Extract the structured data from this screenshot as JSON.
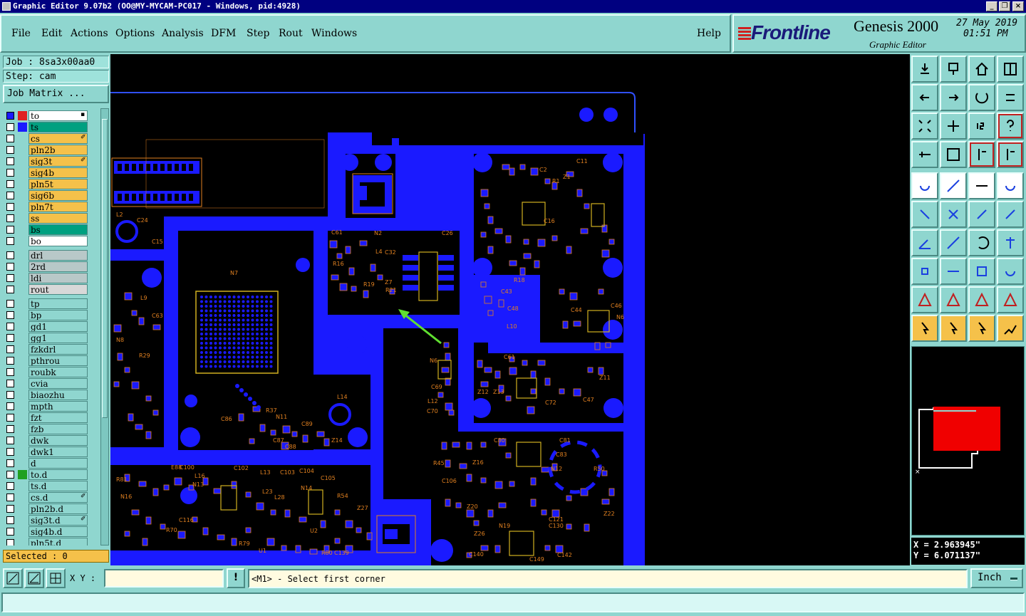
{
  "window": {
    "title": "Graphic Editor 9.07b2  (OO@MY-MYCAM-PC017 - Windows, pid:4928)",
    "minimize_glyph": "_",
    "restore_glyph": "❐",
    "close_glyph": "×"
  },
  "menu": {
    "items": [
      "File",
      "Edit",
      "Actions",
      "Options",
      "Analysis",
      "DFM",
      "Step",
      "Rout",
      "Windows"
    ],
    "help": "Help"
  },
  "brand": {
    "logo": "Frontline",
    "product": "Genesis 2000",
    "subtitle": "Graphic Editor",
    "date": "27 May 2019",
    "time": "01:51 PM"
  },
  "job": {
    "job_label": "Job : 8sa3x00aa0",
    "step_label": "Step: cam",
    "matrix_button": "Job Matrix ..."
  },
  "layers": [
    {
      "name": "to",
      "bg": "#ffffff",
      "swatch": "#e02020",
      "mark": "▪"
    },
    {
      "name": "ts",
      "bg": "#00a080",
      "swatch": "#1a1aff",
      "mark": ""
    },
    {
      "name": "cs",
      "bg": "#f5c14a",
      "swatch": "",
      "mark": "✐"
    },
    {
      "name": "pln2b",
      "bg": "#f5c14a",
      "swatch": "",
      "mark": ""
    },
    {
      "name": "sig3t",
      "bg": "#f5c14a",
      "swatch": "",
      "mark": "✐"
    },
    {
      "name": "sig4b",
      "bg": "#f5c14a",
      "swatch": "",
      "mark": ""
    },
    {
      "name": "pln5t",
      "bg": "#f5c14a",
      "swatch": "",
      "mark": ""
    },
    {
      "name": "sig6b",
      "bg": "#f5c14a",
      "swatch": "",
      "mark": ""
    },
    {
      "name": "pln7t",
      "bg": "#f5c14a",
      "swatch": "",
      "mark": ""
    },
    {
      "name": "ss",
      "bg": "#f5c14a",
      "swatch": "",
      "mark": ""
    },
    {
      "name": "bs",
      "bg": "#00a080",
      "swatch": "",
      "mark": ""
    },
    {
      "name": "bo",
      "bg": "#ffffff",
      "swatch": "",
      "mark": ""
    },
    {
      "name": "drl",
      "bg": "#b8c8c8",
      "swatch": "",
      "mark": ""
    },
    {
      "name": "2rd",
      "bg": "#b8c8c8",
      "swatch": "",
      "mark": ""
    },
    {
      "name": "ldi",
      "bg": "#b8c8c8",
      "swatch": "",
      "mark": ""
    },
    {
      "name": "rout",
      "bg": "#d8d8d8",
      "swatch": "",
      "mark": ""
    },
    {
      "name": "tp",
      "bg": "#8fd6cf",
      "swatch": "",
      "mark": ""
    },
    {
      "name": "bp",
      "bg": "#8fd6cf",
      "swatch": "",
      "mark": ""
    },
    {
      "name": "gd1",
      "bg": "#8fd6cf",
      "swatch": "",
      "mark": ""
    },
    {
      "name": "gg1",
      "bg": "#8fd6cf",
      "swatch": "",
      "mark": ""
    },
    {
      "name": "fzkdrl",
      "bg": "#8fd6cf",
      "swatch": "",
      "mark": ""
    },
    {
      "name": "pthrou",
      "bg": "#8fd6cf",
      "swatch": "",
      "mark": ""
    },
    {
      "name": "roubk",
      "bg": "#8fd6cf",
      "swatch": "",
      "mark": ""
    },
    {
      "name": "cvia",
      "bg": "#8fd6cf",
      "swatch": "",
      "mark": ""
    },
    {
      "name": "biaozhu",
      "bg": "#8fd6cf",
      "swatch": "",
      "mark": ""
    },
    {
      "name": "mpth",
      "bg": "#8fd6cf",
      "swatch": "",
      "mark": ""
    },
    {
      "name": "fzt",
      "bg": "#8fd6cf",
      "swatch": "",
      "mark": ""
    },
    {
      "name": "fzb",
      "bg": "#8fd6cf",
      "swatch": "",
      "mark": ""
    },
    {
      "name": "dwk",
      "bg": "#8fd6cf",
      "swatch": "",
      "mark": ""
    },
    {
      "name": "dwk1",
      "bg": "#8fd6cf",
      "swatch": "",
      "mark": ""
    },
    {
      "name": "d",
      "bg": "#8fd6cf",
      "swatch": "",
      "mark": ""
    },
    {
      "name": "to.d",
      "bg": "#8fd6cf",
      "swatch": "#20a020",
      "mark": ""
    },
    {
      "name": "ts.d",
      "bg": "#8fd6cf",
      "swatch": "",
      "mark": ""
    },
    {
      "name": "cs.d",
      "bg": "#8fd6cf",
      "swatch": "",
      "mark": "✐"
    },
    {
      "name": "pln2b.d",
      "bg": "#8fd6cf",
      "swatch": "",
      "mark": ""
    },
    {
      "name": "sig3t.d",
      "bg": "#8fd6cf",
      "swatch": "",
      "mark": "✐"
    },
    {
      "name": "sig4b.d",
      "bg": "#8fd6cf",
      "swatch": "",
      "mark": ""
    },
    {
      "name": "pln5t.d",
      "bg": "#8fd6cf",
      "swatch": "",
      "mark": ""
    }
  ],
  "selected": "Selected : 0",
  "coords": {
    "x": "X = 2.963945\"",
    "y": "Y = 6.071137\""
  },
  "bottom": {
    "xy_label": "X Y :",
    "xy_value": "",
    "excl": "!",
    "prompt": "<M1> - Select first corner",
    "unit": "Inch"
  },
  "status": "",
  "board_labels": {
    "n7": "N7",
    "n2": "N2",
    "c61": "C61",
    "c26": "C26",
    "c32": "C32",
    "l4": "L4",
    "r16": "R16",
    "r19": "R19",
    "z7": "Z7",
    "r21": "R21",
    "c11": "C11",
    "c2": "C2",
    "r1": "R1",
    "z1": "Z1",
    "c16": "C16",
    "c43": "C43",
    "c48": "C48",
    "l10": "L10",
    "r18": "R18",
    "c44": "C44",
    "n6": "N6",
    "c46": "C46",
    "l2": "L2",
    "c24": "C24",
    "c15": "C15",
    "l9": "L9",
    "c63": "C63",
    "n8": "N8",
    "r29": "R29",
    "c86": "C86",
    "r37": "R37",
    "n11": "N11",
    "c87": "C87",
    "c88": "C88",
    "c89": "C89",
    "z14": "Z14",
    "l14": "L14",
    "n6b": "N6",
    "c69": "C69",
    "l12": "L12",
    "c70": "C70",
    "c61b": "C61",
    "z12": "Z12",
    "z13": "Z13",
    "c72": "C72",
    "c47": "C47",
    "z11": "Z11",
    "c80": "C80",
    "c81": "C81",
    "c83": "C83",
    "n12": "N12",
    "z16": "Z16",
    "r50": "R50",
    "c106": "C106",
    "z20": "Z20",
    "z22": "Z22",
    "z26": "Z26",
    "n19": "N19",
    "c121": "C121",
    "c130": "C130",
    "c140": "C140",
    "c142": "C142",
    "c149": "C149",
    "r45": "R45",
    "e88": "E88",
    "c100": "C100",
    "l16": "L16",
    "c102": "C102",
    "l13": "L13",
    "c103": "C103",
    "c104": "C104",
    "c105": "C105",
    "n16": "N16",
    "n13": "N13",
    "l23": "L23",
    "l28": "L28",
    "n14": "N14",
    "r54": "R54",
    "u2": "U2",
    "u1": "U1",
    "r79": "R79",
    "r80": "R80",
    "c139": "C139",
    "c116": "C116",
    "r70": "R70",
    "r81": "R81",
    "z27": "Z27"
  }
}
